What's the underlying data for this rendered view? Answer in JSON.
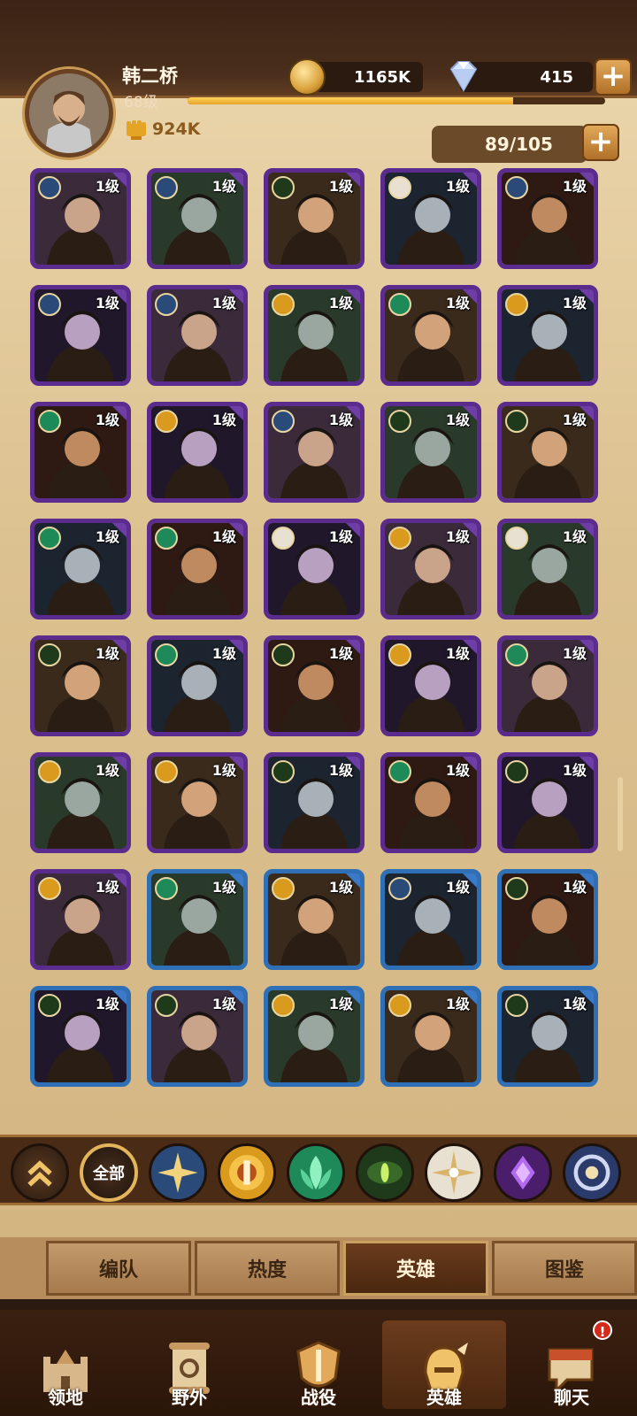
{
  "player": {
    "name": "韩二桥",
    "level": "68级",
    "power": "924K",
    "xp_fraction": 0.78
  },
  "currency": {
    "gold": "1165K",
    "gems": "415",
    "plus_label": "+"
  },
  "roster": {
    "count": "89/105"
  },
  "heroes": [
    {
      "level": "1级",
      "faction": "celestial-gold",
      "frame": "purple"
    },
    {
      "level": "1级",
      "faction": "celestial-gold",
      "frame": "purple"
    },
    {
      "level": "1级",
      "faction": "graveborn",
      "frame": "purple"
    },
    {
      "level": "1级",
      "faction": "lightbearer",
      "frame": "purple"
    },
    {
      "level": "1级",
      "faction": "celestial-gold",
      "frame": "purple"
    },
    {
      "level": "1级",
      "faction": "celestial-gold",
      "frame": "purple"
    },
    {
      "level": "1级",
      "faction": "celestial-gold",
      "frame": "purple"
    },
    {
      "level": "1级",
      "faction": "mauler",
      "frame": "purple"
    },
    {
      "level": "1级",
      "faction": "wilder",
      "frame": "purple"
    },
    {
      "level": "1级",
      "faction": "mauler",
      "frame": "purple"
    },
    {
      "level": "1级",
      "faction": "wilder",
      "frame": "purple"
    },
    {
      "level": "1级",
      "faction": "mauler",
      "frame": "purple"
    },
    {
      "level": "1级",
      "faction": "celestial-gold",
      "frame": "purple"
    },
    {
      "level": "1级",
      "faction": "graveborn",
      "frame": "purple"
    },
    {
      "level": "1级",
      "faction": "graveborn",
      "frame": "purple"
    },
    {
      "level": "1级",
      "faction": "wilder",
      "frame": "purple"
    },
    {
      "level": "1级",
      "faction": "wilder",
      "frame": "purple"
    },
    {
      "level": "1级",
      "faction": "lightbearer",
      "frame": "purple"
    },
    {
      "level": "1级",
      "faction": "mauler",
      "frame": "purple"
    },
    {
      "level": "1级",
      "faction": "lightbearer",
      "frame": "purple"
    },
    {
      "level": "1级",
      "faction": "graveborn",
      "frame": "purple"
    },
    {
      "level": "1级",
      "faction": "wilder",
      "frame": "purple"
    },
    {
      "level": "1级",
      "faction": "graveborn",
      "frame": "purple"
    },
    {
      "level": "1级",
      "faction": "mauler",
      "frame": "purple"
    },
    {
      "level": "1级",
      "faction": "wilder",
      "frame": "purple"
    },
    {
      "level": "1级",
      "faction": "mauler",
      "frame": "purple"
    },
    {
      "level": "1级",
      "faction": "mauler",
      "frame": "purple"
    },
    {
      "level": "1级",
      "faction": "graveborn",
      "frame": "purple"
    },
    {
      "level": "1级",
      "faction": "wilder",
      "frame": "purple"
    },
    {
      "level": "1级",
      "faction": "graveborn",
      "frame": "purple"
    },
    {
      "level": "1级",
      "faction": "mauler",
      "frame": "purple"
    },
    {
      "level": "1级",
      "faction": "wilder",
      "frame": "blue"
    },
    {
      "level": "1级",
      "faction": "mauler",
      "frame": "blue"
    },
    {
      "level": "1级",
      "faction": "celestial-gold",
      "frame": "blue"
    },
    {
      "level": "1级",
      "faction": "graveborn",
      "frame": "blue"
    },
    {
      "level": "1级",
      "faction": "graveborn",
      "frame": "blue"
    },
    {
      "level": "1级",
      "faction": "graveborn",
      "frame": "blue"
    },
    {
      "level": "1级",
      "faction": "mauler",
      "frame": "blue"
    },
    {
      "level": "1级",
      "faction": "mauler",
      "frame": "blue"
    },
    {
      "level": "1级",
      "faction": "graveborn",
      "frame": "blue"
    }
  ],
  "filters": {
    "all_label": "全部"
  },
  "subtabs": [
    "编队",
    "热度",
    "英雄",
    "图鉴"
  ],
  "nav": [
    "领地",
    "野外",
    "战役",
    "英雄",
    "聊天"
  ],
  "notification": "!",
  "colors": {
    "celestial-gold": "#2a4a7a",
    "graveborn": "#1f3a1a",
    "lightbearer": "#e8e0d0",
    "mauler": "#d99a1e",
    "wilder": "#1e8a5a"
  }
}
